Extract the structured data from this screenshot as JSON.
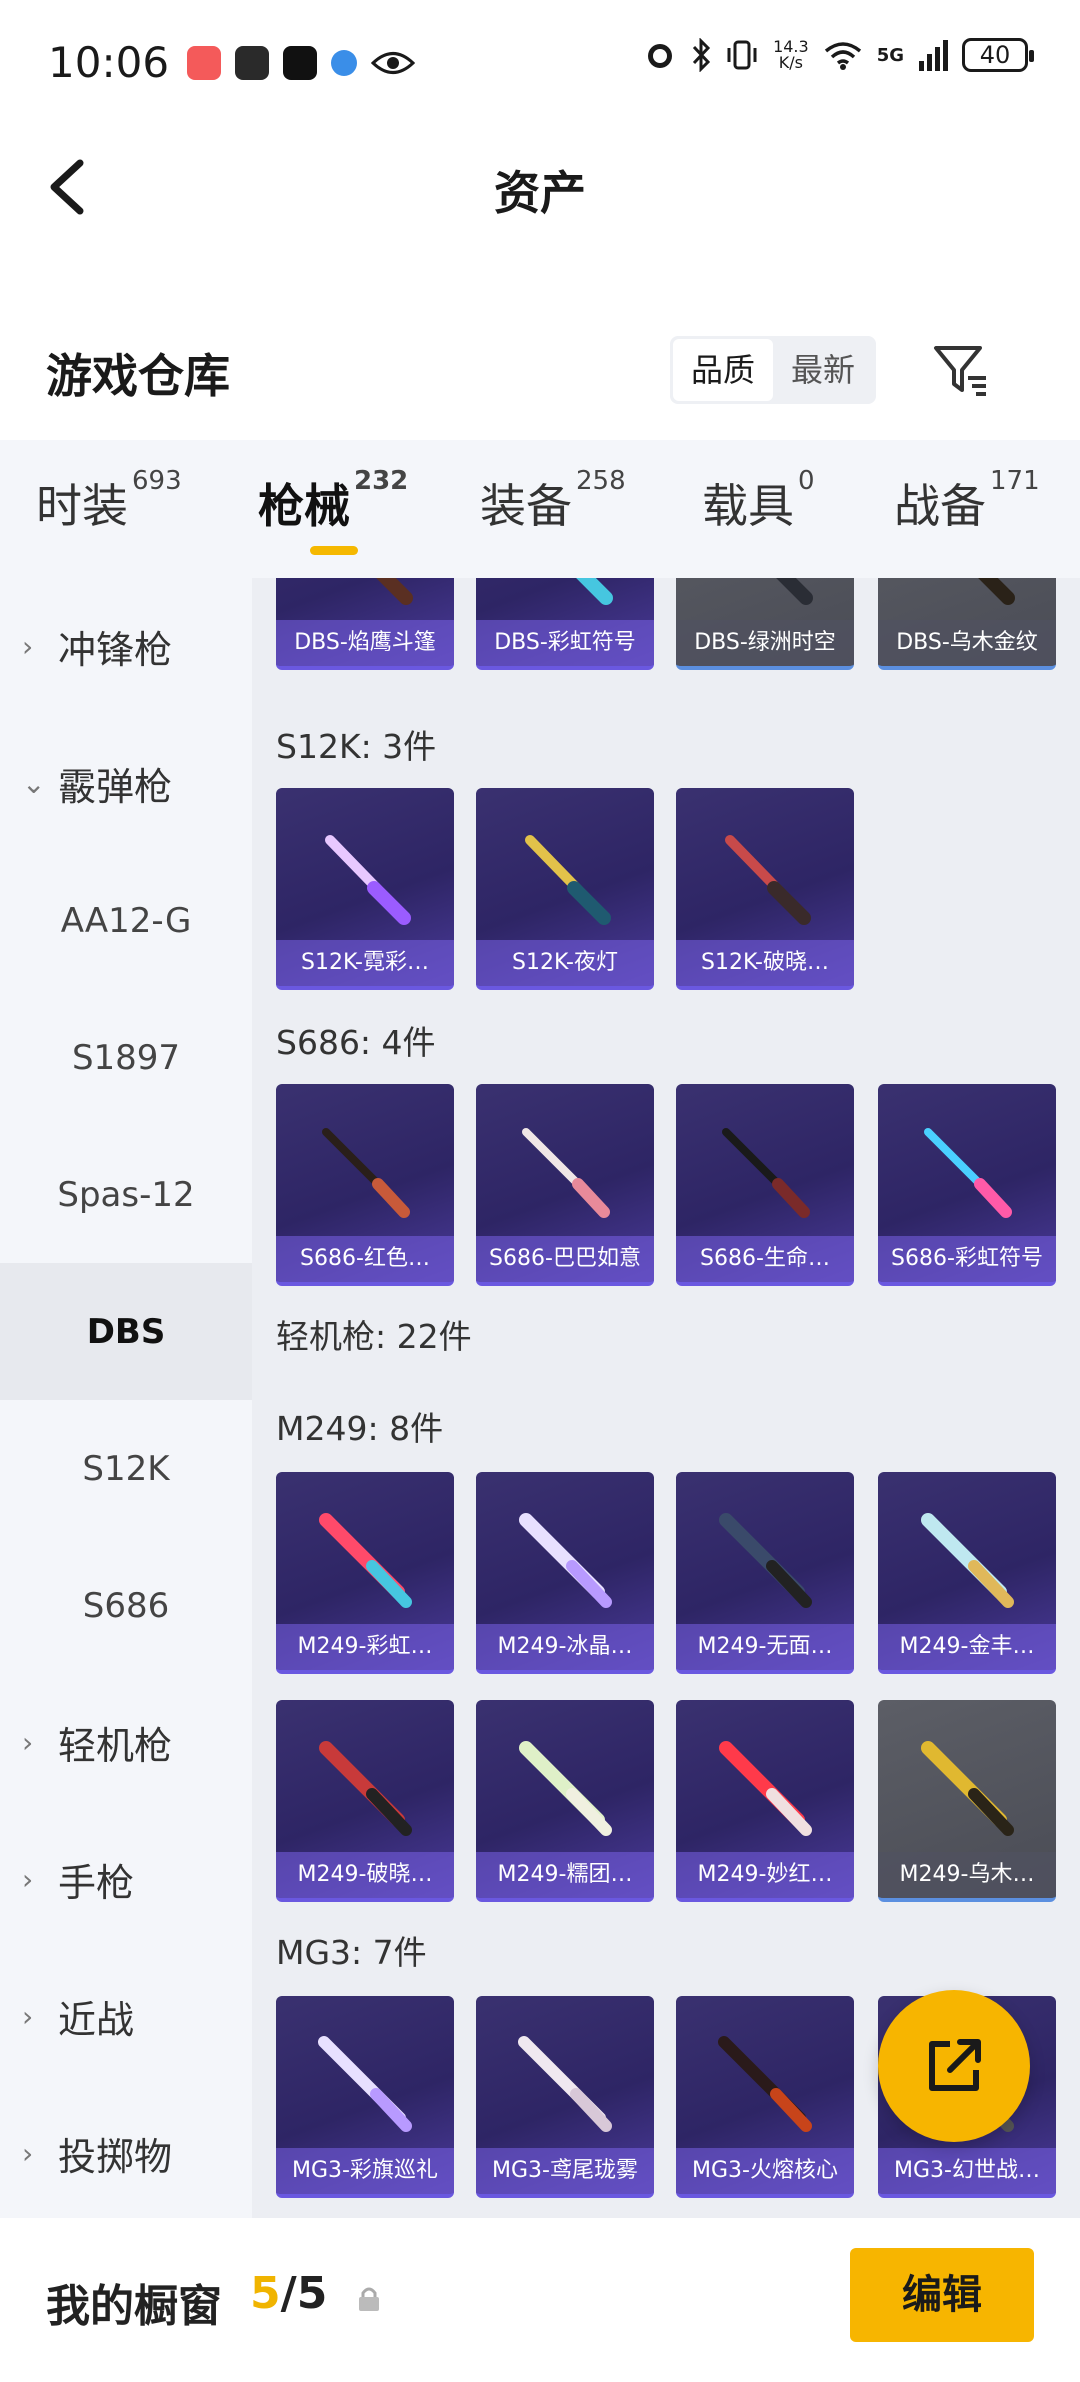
{
  "status_bar": {
    "time": "10:06",
    "net_speed_top": "14.3",
    "net_speed_unit": "K/s",
    "signal": "5G",
    "battery": "40"
  },
  "header": {
    "title": "资产"
  },
  "repo": {
    "title": "游戏仓库",
    "sort_options": [
      "品质",
      "最新"
    ],
    "active_sort": "品质"
  },
  "tabs": [
    {
      "label": "时装",
      "count": "693"
    },
    {
      "label": "枪械",
      "count": "232"
    },
    {
      "label": "装备",
      "count": "258"
    },
    {
      "label": "载具",
      "count": "0"
    },
    {
      "label": "战备",
      "count": "171"
    }
  ],
  "active_tab": "枪械",
  "sidebar": [
    {
      "label": "冲锋枪",
      "type": "category",
      "chevron": "right"
    },
    {
      "label": "霰弹枪",
      "type": "category",
      "chevron": "down"
    },
    {
      "label": "AA12-G",
      "type": "sub"
    },
    {
      "label": "S1897",
      "type": "sub"
    },
    {
      "label": "Spas-12",
      "type": "sub"
    },
    {
      "label": "DBS",
      "type": "sub",
      "selected": true
    },
    {
      "label": "S12K",
      "type": "sub"
    },
    {
      "label": "S686",
      "type": "sub"
    },
    {
      "label": "轻机枪",
      "type": "category",
      "chevron": "right"
    },
    {
      "label": "手枪",
      "type": "category",
      "chevron": "right"
    },
    {
      "label": "近战",
      "type": "category",
      "chevron": "right"
    },
    {
      "label": "投掷物",
      "type": "category",
      "chevron": "right"
    }
  ],
  "groups": {
    "dbs_items": [
      "DBS-焰鹰斗篷",
      "DBS-彩虹符号",
      "DBS-绿洲时空",
      "DBS-乌木金纹"
    ],
    "s12k_label": "S12K: 3件",
    "s12k_items": [
      "S12K-霓彩…",
      "S12K-夜灯",
      "S12K-破晓…"
    ],
    "s686_label": "S686: 4件",
    "s686_items": [
      "S686-红色…",
      "S686-巴巴如意",
      "S686-生命…",
      "S686-彩虹符号"
    ],
    "lmg_label": "轻机枪: 22件",
    "m249_label": "M249: 8件",
    "m249_items_row1": [
      "M249-彩虹…",
      "M249-冰晶…",
      "M249-无面…",
      "M249-金丰…"
    ],
    "m249_items_row2": [
      "M249-破晓…",
      "M249-糯团…",
      "M249-妙红…",
      "M249-乌木…"
    ],
    "mg3_label": "MG3: 7件",
    "mg3_items": [
      "MG3-彩旗巡礼",
      "MG3-鸢尾珑雾",
      "MG3-火熔核心",
      "MG3-幻世战…"
    ]
  },
  "bottom": {
    "window_label": "我的橱窗",
    "current": "5",
    "total": "/5",
    "edit_label": "编辑"
  },
  "colors": {
    "accent": "#f7b500",
    "card_purple": "#3a3170",
    "card_grey": "#555760"
  }
}
